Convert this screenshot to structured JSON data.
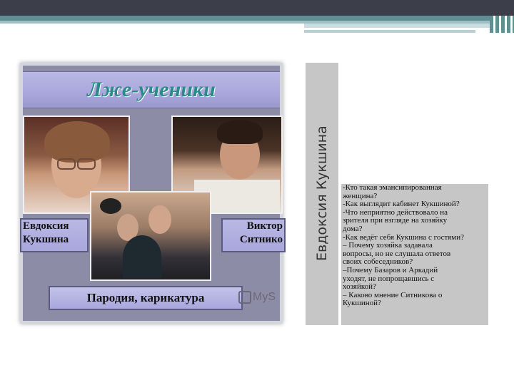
{
  "slide": {
    "title": "Лже-ученики",
    "name_left": "Евдоксия\nКукшина",
    "name_right": "Виктор\nСитнико",
    "parody": "Пародия, карикатура",
    "watermark": "MyS"
  },
  "side_title": "Евдоксия Кукшина",
  "questions": [
    "-Кто  такая эмансипированная\n женщина?",
    "-Как выглядит кабинет Кукшиной?",
    "-Что неприятно действовало на\n зрителя при взгляде на хозяйку\n дома?",
    "-Как ведёт себя Кукшина с гостями?",
    "– Почему хозяйка задавала\n вопросы, но не слушала ответов\n своих собеседников?",
    "–Почему Базаров и Аркадий\n уходят, не попрощавшись с\n хозяйкой?",
    "– Каково мнение Ситникова о\n Кукшиной?"
  ],
  "colors": {
    "header_dark": "#3c3f4a",
    "header_teal": "#5f8f95",
    "panel_gray": "#c6c6c6",
    "slide_title_color": "#2a8a8a",
    "band_lavender": "#a9a7dc"
  }
}
